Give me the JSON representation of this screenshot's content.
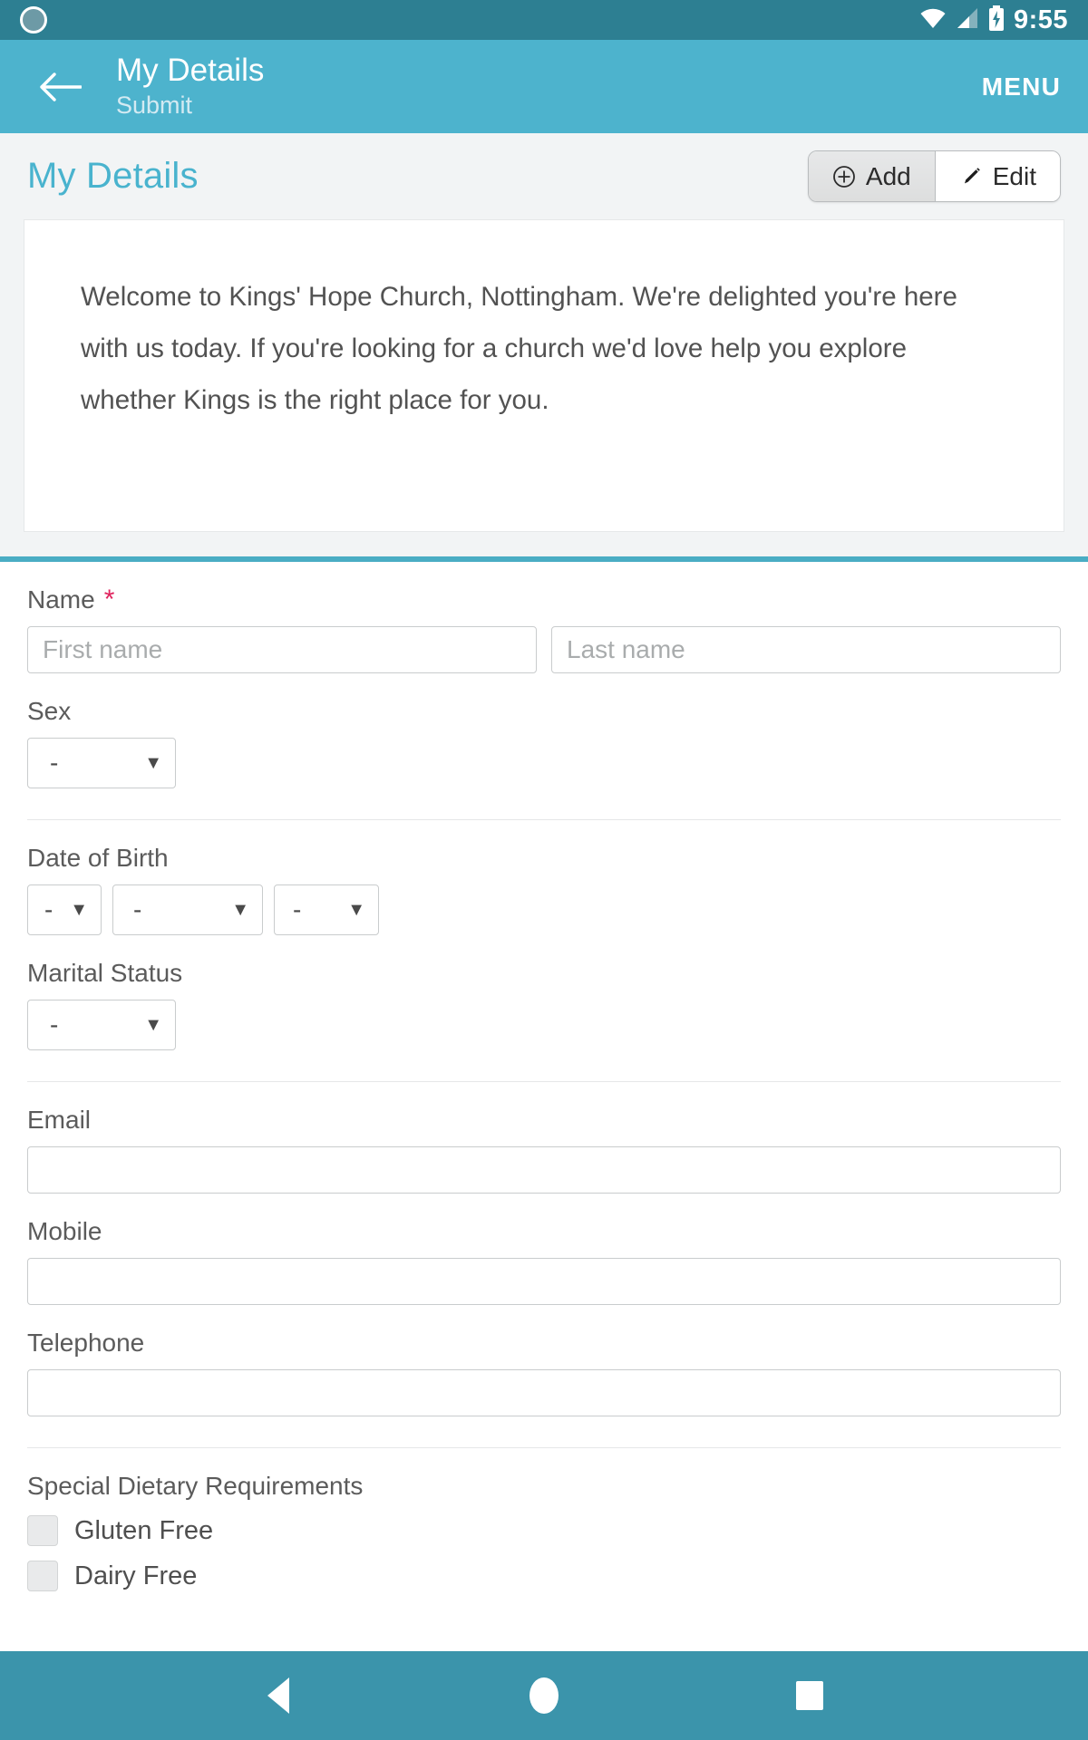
{
  "status_bar": {
    "time": "9:55",
    "icons": [
      "notification-dot",
      "wifi-icon",
      "cell-signal-icon",
      "battery-charging-icon"
    ]
  },
  "app_bar": {
    "back_icon": "back-arrow-icon",
    "title": "My Details",
    "subtitle": "Submit",
    "menu_label": "MENU",
    "background_color": "#4db3cd"
  },
  "page_header": {
    "title": "My Details",
    "title_color": "#49b3ce",
    "segmented": [
      {
        "label": "Add",
        "icon": "plus-circle-icon",
        "selected": true
      },
      {
        "label": "Edit",
        "icon": "pencil-icon",
        "selected": false
      }
    ]
  },
  "welcome": {
    "text": "Welcome to Kings' Hope Church, Nottingham. We're delighted you're here with us today. If you're looking for a church we'd love help you explore whether Kings is the right place for you."
  },
  "form": {
    "name": {
      "label": "Name",
      "required_marker": "*",
      "first_placeholder": "First name",
      "first_value": "",
      "last_placeholder": "Last name",
      "last_value": ""
    },
    "sex": {
      "label": "Sex",
      "value": "-"
    },
    "dob": {
      "label": "Date of Birth",
      "day": "-",
      "month": "-",
      "year": "-"
    },
    "marital": {
      "label": "Marital Status",
      "value": "-"
    },
    "email": {
      "label": "Email",
      "value": ""
    },
    "mobile": {
      "label": "Mobile",
      "value": ""
    },
    "telephone": {
      "label": "Telephone",
      "value": ""
    },
    "dietary": {
      "label": "Special Dietary Requirements",
      "options": [
        {
          "label": "Gluten Free",
          "checked": false
        },
        {
          "label": "Dairy Free",
          "checked": false
        }
      ]
    }
  },
  "nav_bar": {
    "background_color": "#3b94ab",
    "buttons": [
      "back-nav-icon",
      "home-nav-icon",
      "recents-nav-icon"
    ]
  },
  "colors": {
    "accent_teal": "#4db3cd",
    "status_bar": "#2d7f92",
    "rule_teal": "#4aadc4",
    "required_red": "#e0245e"
  }
}
